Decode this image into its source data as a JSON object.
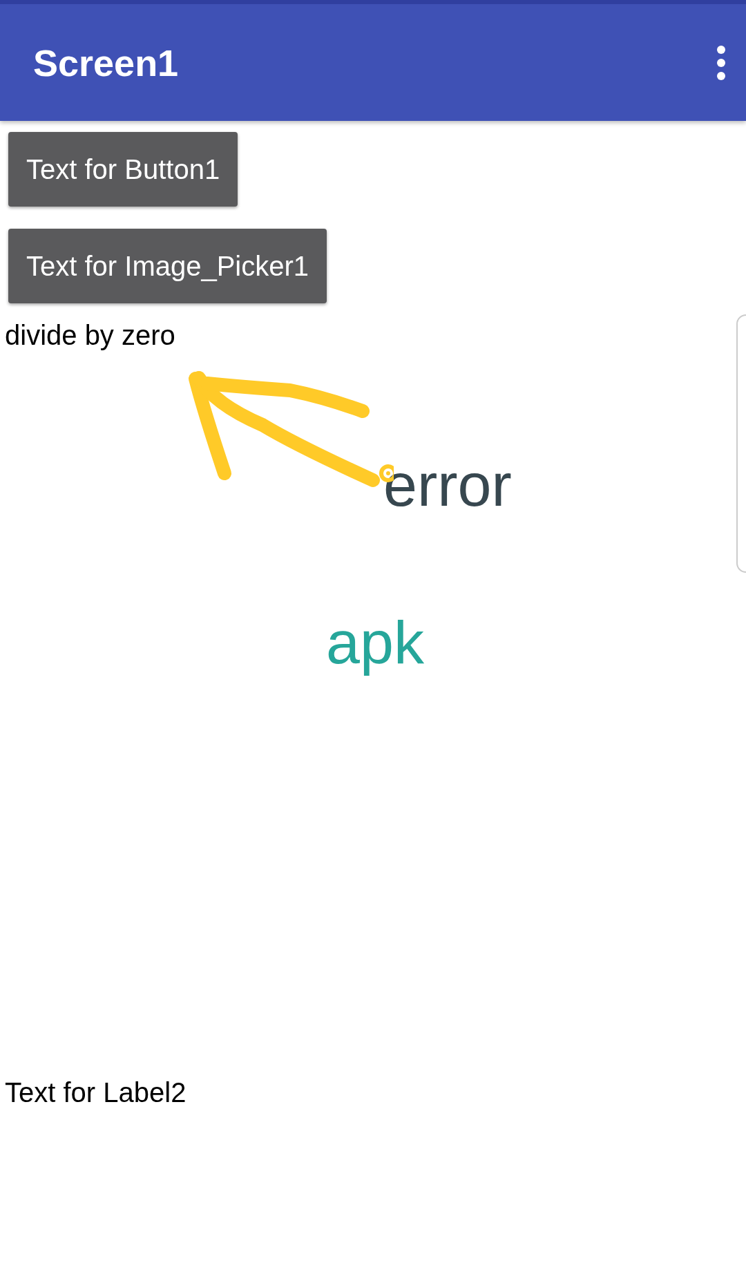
{
  "app_bar": {
    "title": "Screen1"
  },
  "buttons": [
    {
      "label": "Text for Button1"
    },
    {
      "label": "Text for Image_Picker1"
    }
  ],
  "label1": "divide by zero",
  "annotations": [
    {
      "kind": "arrow"
    },
    {
      "kind": "note",
      "text": "error",
      "color": "#37474f"
    },
    {
      "kind": "note",
      "text": "apk",
      "color": "#26a69a"
    }
  ],
  "label2": "Text for Label2"
}
